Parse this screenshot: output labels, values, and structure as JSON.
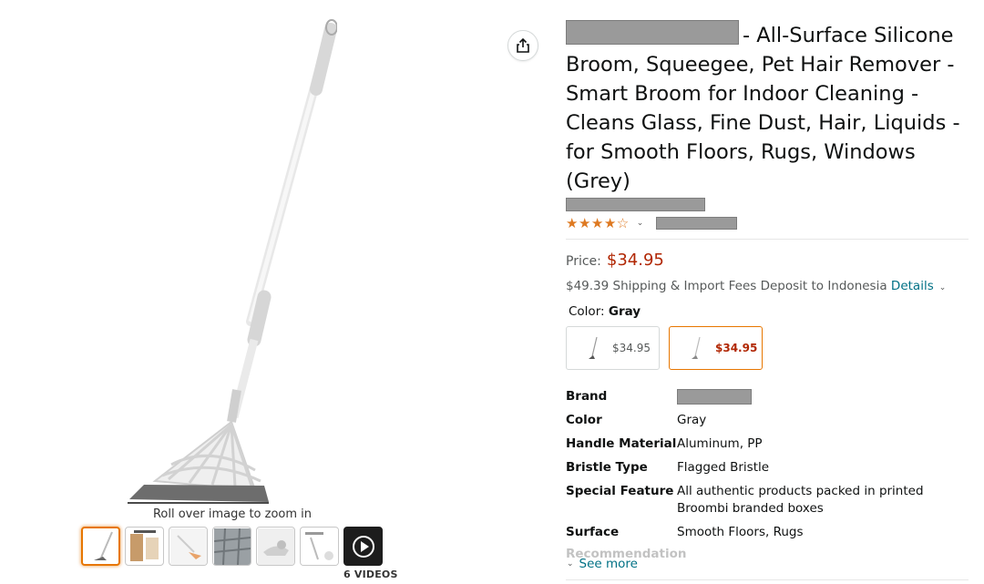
{
  "gallery": {
    "zoom_hint": "Roll over image to zoom in",
    "videos_label": "6 VIDEOS",
    "thumbnails": [
      "broom-full",
      "box-package",
      "broom-sweeping",
      "floor-hair",
      "pet-hair",
      "feature-callouts",
      "video"
    ]
  },
  "product": {
    "title_suffix": "- All-Surface Silicone Broom, Squeegee, Pet Hair Remover - Smart Broom for Indoor Cleaning - Cleans Glass, Fine Dust, Hair, Liquids - for Smooth Floors, Rugs, Windows (Grey)",
    "stars": "★★★★☆",
    "rating_caret": "⌄",
    "price_label": "Price:",
    "price": "$34.95",
    "shipping_text": "$49.39 Shipping & Import Fees Deposit to Indonesia",
    "details_link": "Details",
    "color_label": "Color:",
    "color_value": "Gray",
    "swatches": [
      {
        "price": "$34.95",
        "selected": false
      },
      {
        "price": "$34.95",
        "selected": true
      }
    ]
  },
  "specs": {
    "rows": [
      {
        "key": "Brand",
        "value": ""
      },
      {
        "key": "Color",
        "value": "Gray"
      },
      {
        "key": "Handle Material",
        "value": "Aluminum, PP"
      },
      {
        "key": "Bristle Type",
        "value": "Flagged Bristle"
      },
      {
        "key": "Special Feature",
        "value": "All authentic products packed in printed Broombi branded boxes"
      },
      {
        "key": "Surface",
        "value": "Smooth Floors, Rugs"
      }
    ],
    "faded_row": "Recommendation",
    "see_more": "See more"
  },
  "colors": {
    "accent_orange": "#e77600",
    "price_red": "#b12704",
    "link_teal": "#007185",
    "star": "#de7921",
    "redaction": "#9a9a9a"
  },
  "icons": [
    "share-icon",
    "star-icon",
    "chevron-down-icon",
    "play-icon"
  ]
}
